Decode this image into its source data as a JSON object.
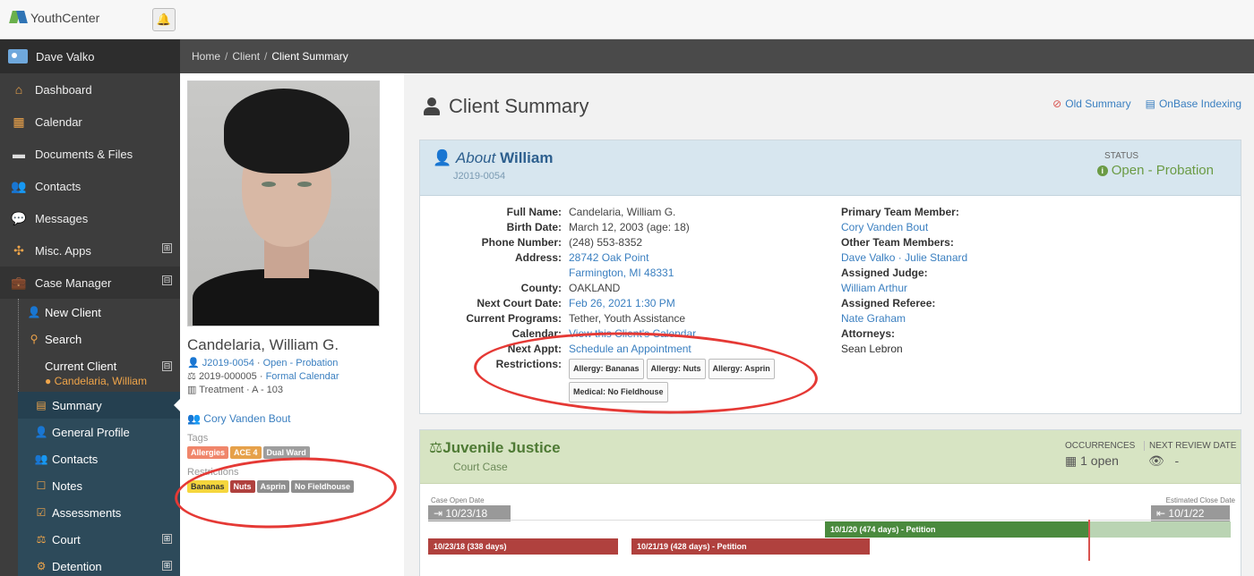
{
  "app": {
    "name": "YouthCenter"
  },
  "sidebar": {
    "user": "Dave Valko",
    "items": [
      {
        "label": "Dashboard",
        "icon": "home-icon"
      },
      {
        "label": "Calendar",
        "icon": "calendar-icon"
      },
      {
        "label": "Documents & Files",
        "icon": "folder-icon"
      },
      {
        "label": "Contacts",
        "icon": "users-icon"
      },
      {
        "label": "Messages",
        "icon": "messages-icon"
      },
      {
        "label": "Misc. Apps",
        "icon": "apps-icon",
        "expand": "⊞"
      },
      {
        "label": "Case Manager",
        "icon": "briefcase-icon",
        "expand": "⊟"
      }
    ],
    "case_manager_sub": {
      "new_client": "New Client",
      "search": "Search",
      "current_client_title": "Current Client",
      "current_client_name": "Candelaria, William",
      "client_items": [
        "Summary",
        "General Profile",
        "Contacts",
        "Notes",
        "Assessments",
        "Court",
        "Detention"
      ]
    }
  },
  "breadcrumb": {
    "home": "Home",
    "client": "Client",
    "current": "Client Summary"
  },
  "profile": {
    "name": "Candelaria, William G.",
    "case_id": "J2019-0054",
    "case_status": "Open - Probation",
    "court_num": "2019-000005",
    "formal_calendar": "Formal Calendar",
    "location": "Treatment · A - 103",
    "team_member": "Cory Vanden Bout",
    "tags_label": "Tags",
    "tags": [
      {
        "label": "Allergies",
        "color": "#f0866b"
      },
      {
        "label": "ACE 4",
        "color": "#e6a14a"
      },
      {
        "label": "Dual Ward",
        "color": "#9e9e9e"
      }
    ],
    "restrictions_label": "Restrictions",
    "restrictions": [
      {
        "label": "Bananas",
        "color": "#f5d63d",
        "text": "#333"
      },
      {
        "label": "Nuts",
        "color": "#b0413e",
        "text": "#fff"
      },
      {
        "label": "Asprin",
        "color": "#8e8e8e",
        "text": "#fff"
      },
      {
        "label": "No Fieldhouse",
        "color": "#8e8e8e",
        "text": "#fff"
      }
    ]
  },
  "main": {
    "title": "Client Summary",
    "old_summary": "Old Summary",
    "onbase": "OnBase Indexing",
    "about": {
      "prefix": "About",
      "name": "William",
      "id": "J2019-0054",
      "status_label": "STATUS",
      "status": "Open - Probation"
    },
    "info": {
      "full_name_k": "Full Name:",
      "full_name": "Candelaria, William G.",
      "birth_k": "Birth Date:",
      "birth": "March 12, 2003 (age: 18)",
      "phone_k": "Phone Number:",
      "phone": "(248) 553-8352",
      "address_k": "Address:",
      "address1": "28742 Oak Point",
      "address2": "Farmington, MI 48331",
      "county_k": "County:",
      "county": "OAKLAND",
      "court_k": "Next Court Date:",
      "court": "Feb 26, 2021 1:30 PM",
      "programs_k": "Current Programs:",
      "programs": "Tether, Youth Assistance",
      "calendar_k": "Calendar:",
      "calendar": "View this Client's Calendar",
      "appt_k": "Next Appt:",
      "appt": "Schedule an Appointment",
      "restrictions_k": "Restrictions:",
      "restrictions": [
        "Allergy: Bananas",
        "Allergy: Nuts",
        "Allergy: Asprin",
        "Medical: No Fieldhouse"
      ]
    },
    "team": {
      "primary_k": "Primary Team Member:",
      "primary": "Cory Vanden Bout",
      "other_k": "Other Team Members:",
      "other": "Dave Valko · Julie Stanard",
      "judge_k": "Assigned Judge:",
      "judge": "William Arthur",
      "referee_k": "Assigned Referee:",
      "referee": "Nate Graham",
      "attorneys_k": "Attorneys:",
      "attorneys": "Sean Lebron"
    },
    "jj": {
      "title": "Juvenile Justice",
      "sub": "Court Case",
      "occ_label": "OCCURRENCES",
      "occ": "1 open",
      "review_label": "NEXT REVIEW DATE",
      "review": "-",
      "open_label": "Case Open Date",
      "open_date": "10/23/18",
      "close_label": "Estimated Close Date",
      "close_date": "10/1/22",
      "bars": [
        {
          "label": "10/1/20 (474 days) - Petition",
          "color": "#4a8a3e"
        },
        {
          "label": "10/23/18 (338 days)",
          "color": "#b0413e"
        },
        {
          "label": "10/21/19 (428 days) - Petition",
          "color": "#b0413e"
        }
      ]
    }
  }
}
